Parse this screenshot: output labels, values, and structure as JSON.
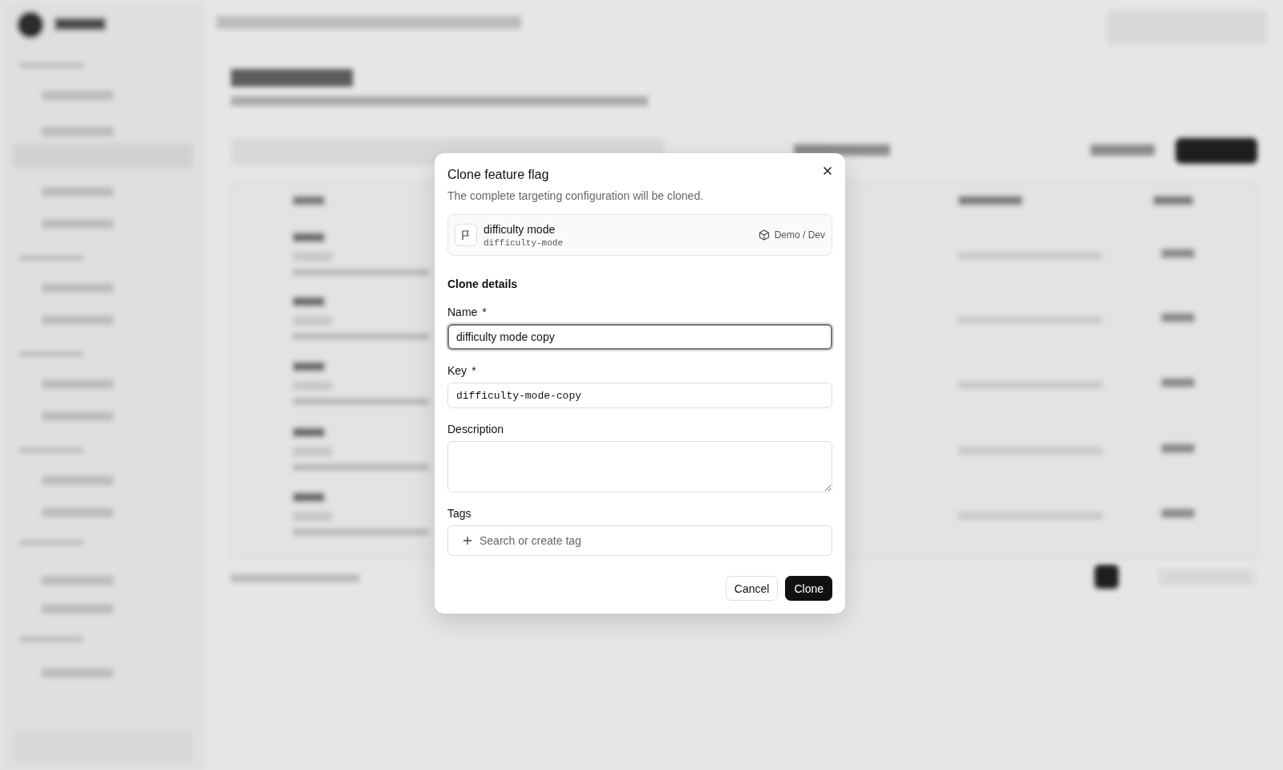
{
  "dialog": {
    "title": "Clone feature flag",
    "subtitle": "The complete targeting configuration will be cloned.",
    "source_flag": {
      "name": "difficulty mode",
      "key": "difficulty-mode",
      "location": "Demo / Dev"
    },
    "section_title": "Clone details",
    "fields": [
      {
        "kind": "text",
        "label": "Name",
        "required_mark": "*",
        "value": "difficulty mode copy",
        "focused": true
      },
      {
        "kind": "mono",
        "label": "Key",
        "required_mark": "*",
        "value": "difficulty-mode-copy",
        "focused": false
      },
      {
        "kind": "textarea",
        "label": "Description"
      },
      {
        "kind": "tags",
        "label": "Tags",
        "placeholder": "Search or create tag"
      }
    ],
    "buttons": [
      {
        "label": "Cancel",
        "kind": "secondary"
      },
      {
        "label": "Clone",
        "kind": "primary"
      }
    ]
  }
}
